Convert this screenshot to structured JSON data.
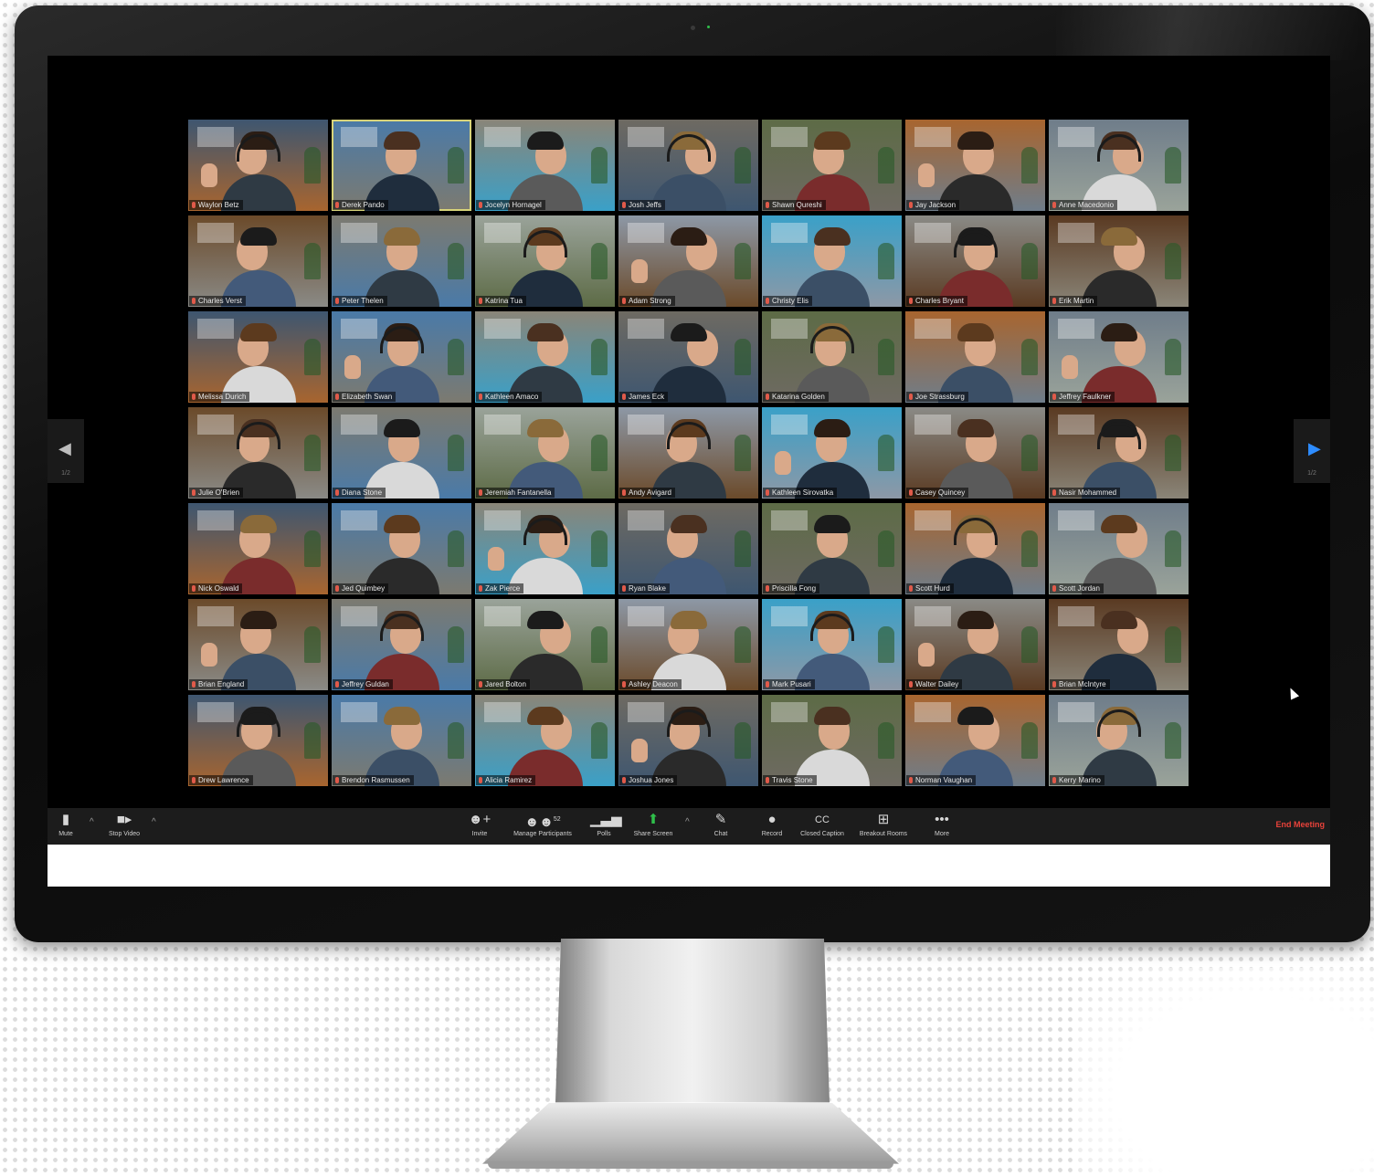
{
  "colors": {
    "accent_blue": "#2d8cff",
    "end_meeting_red": "#e8423a",
    "active_speaker_border": "#d8d47a",
    "toolbar_bg": "#1c1c1c"
  },
  "participants": [
    {
      "name": "Waylon Betz"
    },
    {
      "name": "Derek Pando"
    },
    {
      "name": "Jocelyn Hornagel"
    },
    {
      "name": "Josh Jeffs"
    },
    {
      "name": "Shawn Qureshi"
    },
    {
      "name": "Jay Jackson"
    },
    {
      "name": "Anne Macedonio"
    },
    {
      "name": "Charles Verst"
    },
    {
      "name": "Peter Thelen"
    },
    {
      "name": "Katrina Tua"
    },
    {
      "name": "Adam Strong"
    },
    {
      "name": "Christy Elis"
    },
    {
      "name": "Charles Bryant"
    },
    {
      "name": "Erik Martin"
    },
    {
      "name": "Melissa Durich"
    },
    {
      "name": "Elizabeth Swan"
    },
    {
      "name": "Kathleen Amaco"
    },
    {
      "name": "James Eck"
    },
    {
      "name": "Katarina Golden"
    },
    {
      "name": "Joe Strassburg"
    },
    {
      "name": "Jeffrey Faulkner"
    },
    {
      "name": "Julie O'Brien"
    },
    {
      "name": "Diana Stone"
    },
    {
      "name": "Jeremiah Fantanella"
    },
    {
      "name": "Andy Avigard"
    },
    {
      "name": "Kathleen Sirovatka"
    },
    {
      "name": "Casey Quincey"
    },
    {
      "name": "Nasir Mohammed"
    },
    {
      "name": "Nick Oswald"
    },
    {
      "name": "Jed Quimbey"
    },
    {
      "name": "Zak Pierce"
    },
    {
      "name": "Ryan Blake"
    },
    {
      "name": "Priscilla Fong"
    },
    {
      "name": "Scott Hurd"
    },
    {
      "name": "Scott Jordan"
    },
    {
      "name": "Brian England"
    },
    {
      "name": "Jeffrey Guldan"
    },
    {
      "name": "Jared Bolton"
    },
    {
      "name": "Ashley Deacon"
    },
    {
      "name": "Mark Pusari"
    },
    {
      "name": "Walter Dailey"
    },
    {
      "name": "Brian McIntyre"
    },
    {
      "name": "Drew Lawrence"
    },
    {
      "name": "Brendon Rasmussen"
    },
    {
      "name": "Alicia Ramirez"
    },
    {
      "name": "Joshua Jones"
    },
    {
      "name": "Travis Stone"
    },
    {
      "name": "Norman Vaughan"
    },
    {
      "name": "Kerry Marino"
    }
  ],
  "active_speaker_index": 1,
  "page_nav": {
    "left_arrow": "◀",
    "right_arrow": "▶",
    "left_page": "1/2",
    "right_page": "1/2"
  },
  "toolbar": {
    "mute": {
      "label": "Mute",
      "icon": "microphone-icon",
      "glyph": "🎙"
    },
    "stop_video": {
      "label": "Stop Video",
      "icon": "video-camera-icon",
      "glyph": "■▸"
    },
    "invite": {
      "label": "Invite",
      "icon": "invite-person-icon",
      "glyph": "☺+"
    },
    "manage_participants": {
      "label": "Manage Participants",
      "icon": "participants-icon",
      "glyph": "☺☺",
      "count": "52"
    },
    "polls": {
      "label": "Polls",
      "icon": "polls-bar-icon",
      "glyph": "▁▃▅"
    },
    "share_screen": {
      "label": "Share Screen",
      "icon": "share-screen-icon",
      "glyph": "⬆"
    },
    "chat": {
      "label": "Chat",
      "icon": "chat-bubble-icon",
      "glyph": "…"
    },
    "record": {
      "label": "Record",
      "icon": "record-icon",
      "glyph": "●"
    },
    "closed_caption": {
      "label": "Closed Caption",
      "icon": "closed-caption-icon",
      "glyph": "CC"
    },
    "breakout_rooms": {
      "label": "Breakout Rooms",
      "icon": "breakout-rooms-icon",
      "glyph": "⊞"
    },
    "more": {
      "label": "More",
      "icon": "more-dots-icon",
      "glyph": "•••"
    },
    "caret": "^",
    "end_meeting": "End Meeting"
  }
}
